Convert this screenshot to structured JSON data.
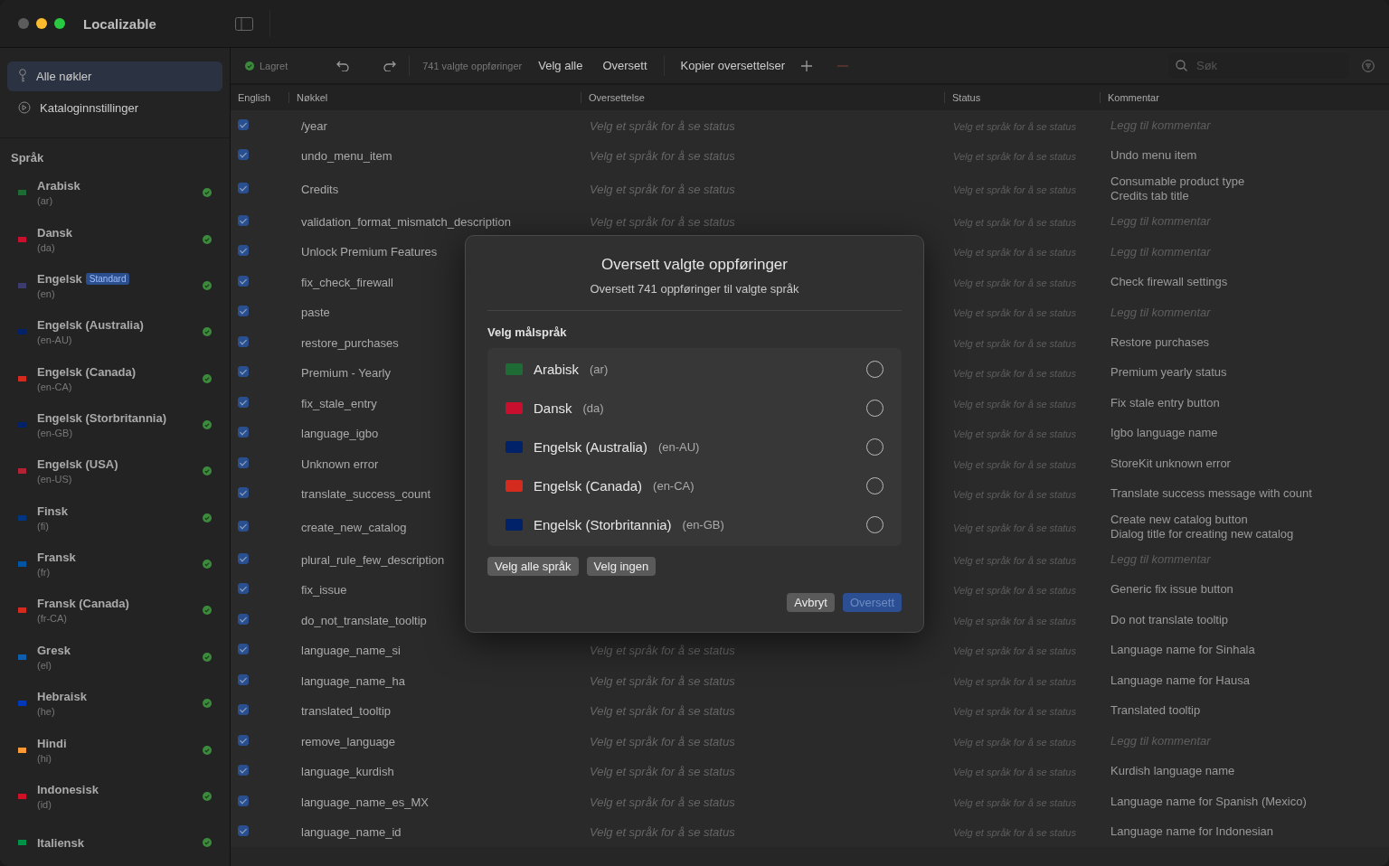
{
  "window": {
    "title": "Localizable"
  },
  "sidebar": {
    "nav": [
      {
        "label": "Alle nøkler",
        "selected": true
      },
      {
        "label": "Kataloginnstillinger",
        "selected": false
      }
    ],
    "section_title": "Språk",
    "languages": [
      {
        "name": "Arabisk",
        "code": "(ar)",
        "color": "#1f6b35"
      },
      {
        "name": "Dansk",
        "code": "(da)",
        "color": "#c8102e"
      },
      {
        "name": "Engelsk",
        "code": "(en)",
        "badge": "Standard",
        "color": "#3c3b6e"
      },
      {
        "name": "Engelsk (Australia)",
        "code": "(en-AU)",
        "color": "#012169"
      },
      {
        "name": "Engelsk (Canada)",
        "code": "(en-CA)",
        "color": "#d52b1e"
      },
      {
        "name": "Engelsk (Storbritannia)",
        "code": "(en-GB)",
        "color": "#012169"
      },
      {
        "name": "Engelsk (USA)",
        "code": "(en-US)",
        "color": "#b22234"
      },
      {
        "name": "Finsk",
        "code": "(fi)",
        "color": "#003580"
      },
      {
        "name": "Fransk",
        "code": "(fr)",
        "color": "#0055a4"
      },
      {
        "name": "Fransk (Canada)",
        "code": "(fr-CA)",
        "color": "#d52b1e"
      },
      {
        "name": "Gresk",
        "code": "(el)",
        "color": "#0d5eaf"
      },
      {
        "name": "Hebraisk",
        "code": "(he)",
        "color": "#0038b8"
      },
      {
        "name": "Hindi",
        "code": "(hi)",
        "color": "#ff9933"
      },
      {
        "name": "Indonesisk",
        "code": "(id)",
        "color": "#ce1126"
      },
      {
        "name": "Italiensk",
        "color": "#009246"
      }
    ]
  },
  "toolbar": {
    "save_status": "Lagret",
    "selection_count": "741 valgte oppføringer",
    "actions": [
      "Velg alle",
      "Oversett"
    ],
    "copy_action": "Kopier oversettelser",
    "search": {
      "placeholder": "Søk"
    }
  },
  "table": {
    "columns": [
      "English",
      "Nøkkel",
      "Oversettelse",
      "Status",
      "Kommentar"
    ],
    "rows": [
      {
        "checked": true,
        "key": "/year",
        "translation": "Velg et språk for å se status",
        "status": "Velg et språk for å se status",
        "comment_placeholder": "Legg til kommentar"
      },
      {
        "checked": true,
        "key": "undo_menu_item",
        "translation": "Velg et språk for å se status",
        "status": "Velg et språk for å se status",
        "comment": [
          "Undo menu item"
        ]
      },
      {
        "checked": true,
        "key": "Credits",
        "translation": "Velg et språk for å se status",
        "status": "Velg et språk for å se status",
        "comment": [
          "Consumable product type",
          "Credits tab title"
        ]
      },
      {
        "checked": true,
        "key": "validation_format_mismatch_description",
        "translation": "Velg et språk for å se status",
        "status": "Velg et språk for å se status",
        "comment_placeholder": "Legg til kommentar"
      },
      {
        "checked": true,
        "key": "Unlock Premium Features",
        "status": "Velg et språk for å se status",
        "comment_placeholder": "Legg til kommentar"
      },
      {
        "checked": true,
        "key": "fix_check_firewall",
        "status": "Velg et språk for å se status",
        "comment": [
          "Check firewall settings"
        ]
      },
      {
        "checked": true,
        "key": "paste",
        "status": "Velg et språk for å se status",
        "comment_placeholder": "Legg til kommentar"
      },
      {
        "checked": true,
        "key": "restore_purchases",
        "status": "Velg et språk for å se status",
        "comment": [
          "Restore purchases"
        ]
      },
      {
        "checked": true,
        "key": "Premium - Yearly",
        "status": "Velg et språk for å se status",
        "comment": [
          "Premium yearly status"
        ]
      },
      {
        "checked": true,
        "key": "fix_stale_entry",
        "status": "Velg et språk for å se status",
        "comment": [
          "Fix stale entry button"
        ]
      },
      {
        "checked": true,
        "key": "language_igbo",
        "status": "Velg et språk for å se status",
        "comment": [
          "Igbo language name"
        ]
      },
      {
        "checked": true,
        "key": "Unknown error",
        "status": "Velg et språk for å se status",
        "comment": [
          "StoreKit unknown error"
        ]
      },
      {
        "checked": true,
        "key": "translate_success_count",
        "status": "Velg et språk for å se status",
        "comment": [
          "Translate success message with count"
        ]
      },
      {
        "checked": true,
        "key": "create_new_catalog",
        "status": "Velg et språk for å se status",
        "comment": [
          "Create new catalog button",
          "Dialog title for creating new catalog"
        ]
      },
      {
        "checked": true,
        "key": "plural_rule_few_description",
        "status": "Velg et språk for å se status",
        "comment_placeholder": "Legg til kommentar"
      },
      {
        "checked": true,
        "key": "fix_issue",
        "status": "Velg et språk for å se status",
        "comment": [
          "Generic fix issue button"
        ]
      },
      {
        "checked": true,
        "key": "do_not_translate_tooltip",
        "status": "Velg et språk for å se status",
        "comment": [
          "Do not translate tooltip"
        ]
      },
      {
        "checked": true,
        "key": "language_name_si",
        "translation": "Velg et språk for å se status",
        "status": "Velg et språk for å se status",
        "comment": [
          "Language name for Sinhala"
        ]
      },
      {
        "checked": true,
        "key": "language_name_ha",
        "translation": "Velg et språk for å se status",
        "status": "Velg et språk for å se status",
        "comment": [
          "Language name for Hausa"
        ]
      },
      {
        "checked": true,
        "key": "translated_tooltip",
        "translation": "Velg et språk for å se status",
        "status": "Velg et språk for å se status",
        "comment": [
          "Translated tooltip"
        ]
      },
      {
        "checked": true,
        "key": "remove_language",
        "translation": "Velg et språk for å se status",
        "status": "Velg et språk for å se status",
        "comment_placeholder": "Legg til kommentar"
      },
      {
        "checked": true,
        "key": "language_kurdish",
        "translation": "Velg et språk for å se status",
        "status": "Velg et språk for å se status",
        "comment": [
          "Kurdish language name"
        ]
      },
      {
        "checked": true,
        "key": "language_name_es_MX",
        "translation": "Velg et språk for å se status",
        "status": "Velg et språk for å se status",
        "comment": [
          "Language name for Spanish (Mexico)"
        ]
      },
      {
        "checked": true,
        "key": "language_name_id",
        "translation": "Velg et språk for å se status",
        "status": "Velg et språk for å se status",
        "comment": [
          "Language name for Indonesian"
        ]
      }
    ]
  },
  "dialog": {
    "title": "Oversett valgte oppføringer",
    "subtitle": "Oversett 741 oppføringer til valgte språk",
    "section_title": "Velg målspråk",
    "languages": [
      {
        "name": "Arabisk",
        "code": "(ar)",
        "color": "#1f6b35",
        "selected": false
      },
      {
        "name": "Dansk",
        "code": "(da)",
        "color": "#c8102e",
        "selected": false
      },
      {
        "name": "Engelsk (Australia)",
        "code": "(en-AU)",
        "color": "#012169",
        "selected": false
      },
      {
        "name": "Engelsk (Canada)",
        "code": "(en-CA)",
        "color": "#d52b1e",
        "selected": false
      },
      {
        "name": "Engelsk (Storbritannia)",
        "code": "(en-GB)",
        "color": "#012169",
        "selected": false
      }
    ],
    "select_buttons": [
      "Velg alle språk",
      "Velg ingen"
    ],
    "cancel": "Avbryt",
    "confirm": {
      "label": "Oversett",
      "disabled": true
    }
  }
}
